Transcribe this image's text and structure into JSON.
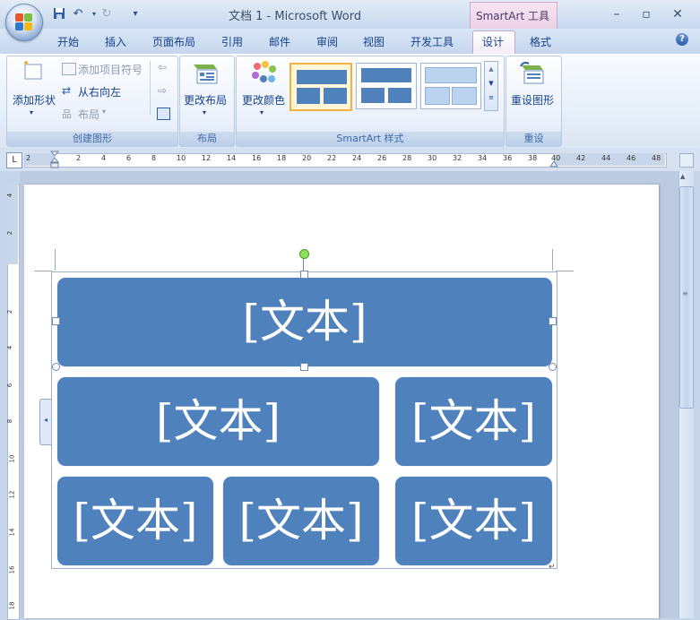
{
  "window": {
    "title": "文档 1 - Microsoft Word",
    "contextual_title": "SmartArt 工具"
  },
  "tabs": [
    "开始",
    "插入",
    "页面布局",
    "引用",
    "邮件",
    "审阅",
    "视图",
    "开发工具",
    "设计",
    "格式"
  ],
  "ribbon": {
    "create_group": {
      "label": "创建图形",
      "add_shape": "添加形状",
      "add_bullet": "添加项目符号",
      "right_to_left": "从右向左",
      "layout": "布局"
    },
    "layout_group": {
      "label": "布局",
      "change_layout": "更改布局"
    },
    "styles_group": {
      "label": "SmartArt 样式",
      "change_colors": "更改颜色"
    },
    "reset_group": {
      "label": "重设",
      "reset_graphic": "重设图形"
    }
  },
  "ruler": {
    "numbers": [
      "2",
      "2",
      "4",
      "6",
      "8",
      "10",
      "12",
      "14",
      "16",
      "18",
      "20",
      "22",
      "24",
      "26",
      "28",
      "30",
      "32",
      "34",
      "36",
      "38",
      "40",
      "42",
      "44",
      "46",
      "48"
    ],
    "vertical_numbers": [
      "4",
      "2",
      "2",
      "4",
      "6",
      "8",
      "10",
      "12",
      "14",
      "16",
      "18"
    ]
  },
  "smartart": {
    "shapes": [
      "[文本]",
      "[文本]",
      "[文本]",
      "[文本]",
      "[文本]",
      "[文本]"
    ]
  },
  "colors": {
    "shape_fill": "#4f81bd",
    "ribbon_text": "#15428b",
    "contextual_tab": "#ead0e6"
  }
}
